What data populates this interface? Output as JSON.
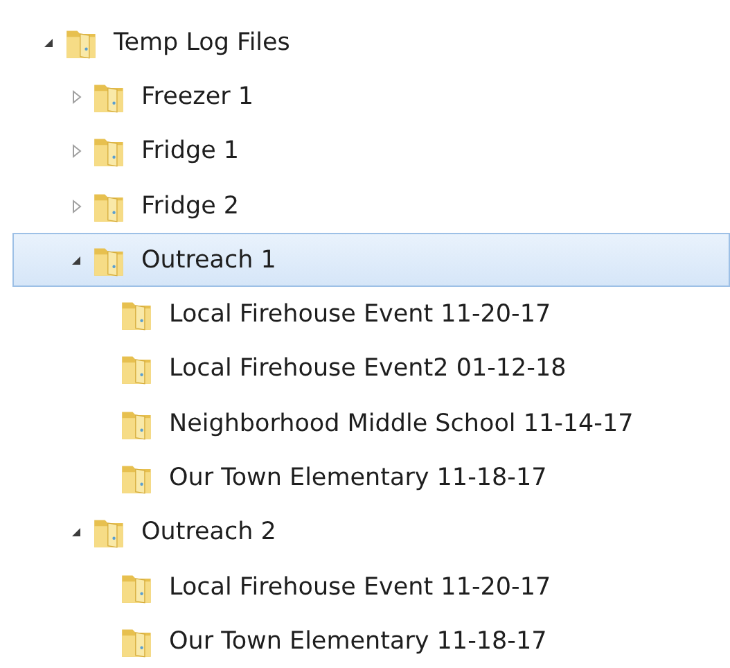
{
  "tree": [
    {
      "label": "Temp Log Files",
      "expanded": true,
      "selected": false,
      "children": [
        {
          "label": "Freezer 1",
          "expanded": false,
          "selected": false
        },
        {
          "label": "Fridge 1",
          "expanded": false,
          "selected": false
        },
        {
          "label": "Fridge 2",
          "expanded": false,
          "selected": false
        },
        {
          "label": "Outreach 1",
          "expanded": true,
          "selected": true,
          "children": [
            {
              "label": "Local Firehouse Event 11-20-17",
              "selected": false
            },
            {
              "label": "Local Firehouse Event2 01-12-18",
              "selected": false
            },
            {
              "label": "Neighborhood Middle School 11-14-17",
              "selected": false
            },
            {
              "label": "Our Town Elementary 11-18-17",
              "selected": false
            }
          ]
        },
        {
          "label": "Outreach 2",
          "expanded": true,
          "selected": false,
          "children": [
            {
              "label": "Local Firehouse Event 11-20-17",
              "selected": false
            },
            {
              "label": "Our Town Elementary 11-18-17",
              "selected": false
            }
          ]
        }
      ]
    }
  ]
}
